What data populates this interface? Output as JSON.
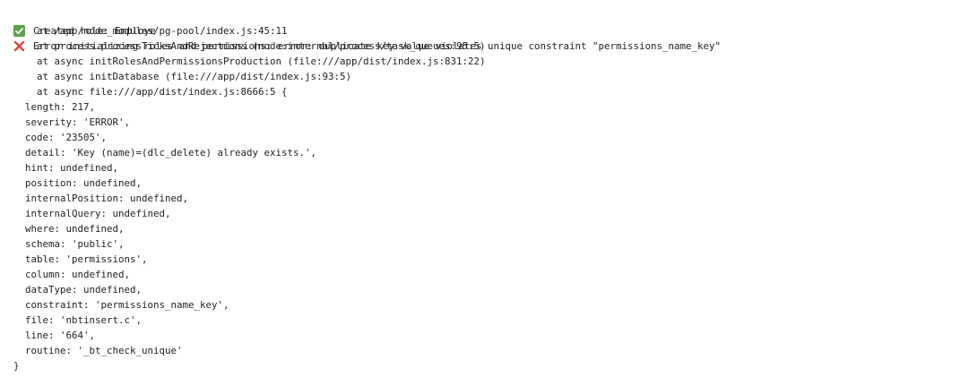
{
  "console": {
    "success_message": "Created role: Employe",
    "error_message": "Error initializing roles and permissions: error: duplicate key value violates unique constraint \"permissions_name_key\"",
    "stack": [
      "at /app/node_modules/pg-pool/index.js:45:11",
      "at process.processTicksAndRejections (node:internal/process/task_queues:95:5)",
      "at async initRolesAndPermissionsProduction (file:///app/dist/index.js:831:22)",
      "at async initDatabase (file:///app/dist/index.js:93:5)",
      "at async file:///app/dist/index.js:8666:5 {"
    ],
    "props": [
      "length: 217,",
      "severity: 'ERROR',",
      "code: '23505',",
      "detail: 'Key (name)=(dlc_delete) already exists.',",
      "hint: undefined,",
      "position: undefined,",
      "internalPosition: undefined,",
      "internalQuery: undefined,",
      "where: undefined,",
      "schema: 'public',",
      "table: 'permissions',",
      "column: undefined,",
      "dataType: undefined,",
      "constraint: 'permissions_name_key',",
      "file: 'nbtinsert.c',",
      "line: '664',",
      "routine: '_bt_check_unique'"
    ],
    "closing": "}"
  },
  "icons": {
    "success": "check-mark-icon",
    "error": "cross-mark-icon"
  },
  "colors": {
    "success_icon": "#5aa54a",
    "error_icon": "#e0463a",
    "text": "#1f1f1f"
  }
}
